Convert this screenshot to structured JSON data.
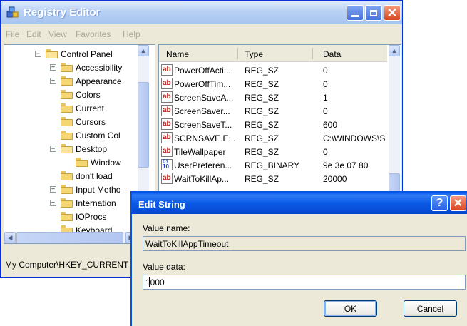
{
  "registry": {
    "title": "Registry Editor",
    "menu": [
      "File",
      "Edit",
      "View",
      "Favorites",
      "Help"
    ],
    "tree": [
      {
        "label": "Control Panel",
        "expander": "minus",
        "state": "open"
      },
      {
        "label": "Accessibility",
        "expander": "plus",
        "state": "closed"
      },
      {
        "label": "Appearance",
        "expander": "plus",
        "state": "closed"
      },
      {
        "label": "Colors",
        "expander": "",
        "state": "closed"
      },
      {
        "label": "Current",
        "expander": "",
        "state": "closed"
      },
      {
        "label": "Cursors",
        "expander": "",
        "state": "closed"
      },
      {
        "label": "Custom Col",
        "expander": "",
        "state": "closed"
      },
      {
        "label": "Desktop",
        "expander": "minus",
        "state": "open"
      },
      {
        "label": "Window",
        "expander": "",
        "state": "closed"
      },
      {
        "label": "don't load",
        "expander": "",
        "state": "closed"
      },
      {
        "label": "Input Metho",
        "expander": "plus",
        "state": "closed"
      },
      {
        "label": "Internation",
        "expander": "plus",
        "state": "closed"
      },
      {
        "label": "IOProcs",
        "expander": "",
        "state": "closed"
      },
      {
        "label": "Keyboard",
        "expander": "",
        "state": "closed"
      }
    ],
    "columns": {
      "name": "Name",
      "type": "Type",
      "data": "Data"
    },
    "values": [
      {
        "name": "PowerOffActi...",
        "type": "REG_SZ",
        "data": "0",
        "icon": "string-value-icon"
      },
      {
        "name": "PowerOffTim...",
        "type": "REG_SZ",
        "data": "0",
        "icon": "string-value-icon"
      },
      {
        "name": "ScreenSaveA...",
        "type": "REG_SZ",
        "data": "1",
        "icon": "string-value-icon"
      },
      {
        "name": "ScreenSaver...",
        "type": "REG_SZ",
        "data": "0",
        "icon": "string-value-icon"
      },
      {
        "name": "ScreenSaveT...",
        "type": "REG_SZ",
        "data": "600",
        "icon": "string-value-icon"
      },
      {
        "name": "SCRNSAVE.E...",
        "type": "REG_SZ",
        "data": "C:\\WINDOWS\\S",
        "icon": "string-value-icon"
      },
      {
        "name": "TileWallpaper",
        "type": "REG_SZ",
        "data": "0",
        "icon": "string-value-icon"
      },
      {
        "name": "UserPreferen...",
        "type": "REG_BINARY",
        "data": "9e 3e 07 80",
        "icon": "binary-value-icon"
      },
      {
        "name": "WaitToKillAp...",
        "type": "REG_SZ",
        "data": "20000",
        "icon": "string-value-icon"
      }
    ],
    "status": "My Computer\\HKEY_CURRENT"
  },
  "dialog": {
    "title": "Edit String",
    "value_name_label": "Value name:",
    "value_name": "WaitToKillAppTimeout",
    "value_data_label": "Value data:",
    "value_data": "1000",
    "ok_label": "OK",
    "cancel_label": "Cancel",
    "help_glyph": "?",
    "close_glyph": "✕"
  },
  "colors": {
    "xp_title_blue": "#0554e3",
    "close_red": "#d8461f",
    "dialog_face": "#ece9d8"
  }
}
